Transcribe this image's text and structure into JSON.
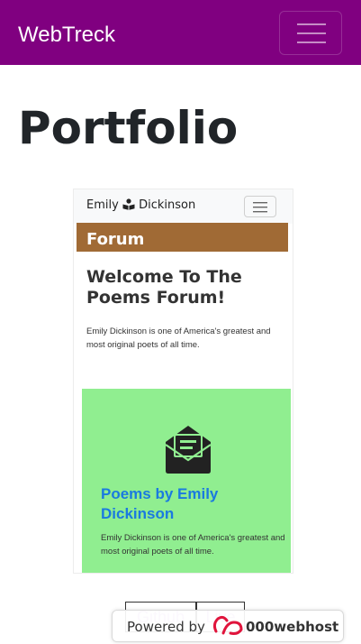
{
  "navbar": {
    "brand": "WebTreck",
    "toggler_icon": "hamburger-icon",
    "background": "#800080"
  },
  "page": {
    "title": "Portfolio"
  },
  "preview": {
    "brand_first": "Emily",
    "brand_icon": "reader-icon",
    "brand_last": "Dickinson",
    "toggler_icon": "hamburger-icon",
    "forum_label": "Forum",
    "welcome_title": "Welcome To The Poems Forum!",
    "intro_text": "Emily Dickinson is one of America's greatest and most original poets of all time.",
    "card": {
      "icon": "envelope-open-icon",
      "title": "Poems by Emily Dickinson",
      "text": "Emily Dickinson is one of America's greatest and most original poets of all time.",
      "background": "#90ee90"
    }
  },
  "actions": {
    "github_label": "Github",
    "live_label": "Live"
  },
  "badge": {
    "prefix": "Powered by",
    "logo_icon": "000webhost-logo-icon",
    "brand": "000webhost"
  }
}
